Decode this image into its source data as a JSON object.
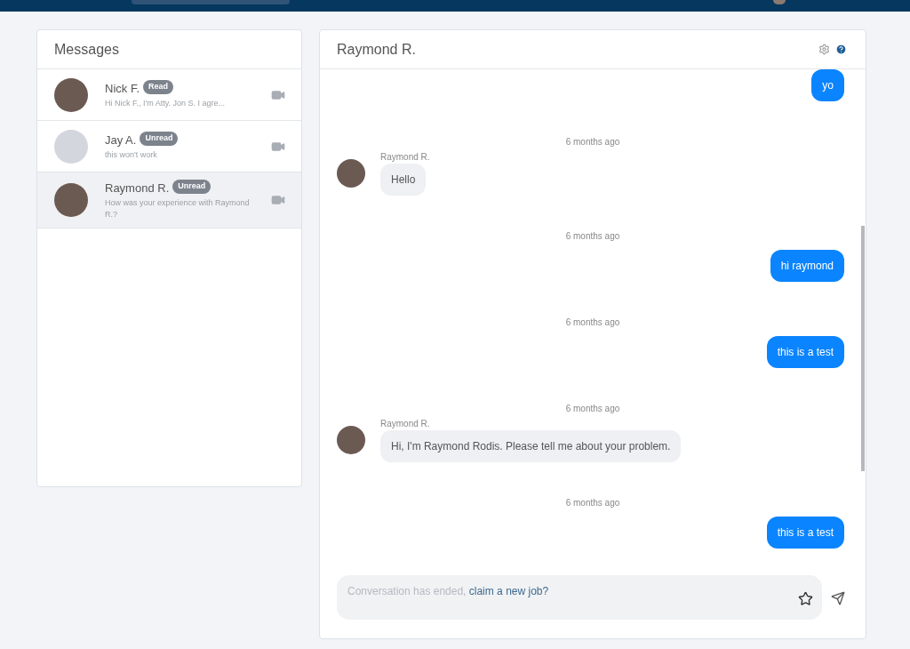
{
  "sidebar": {
    "title": "Messages",
    "conversations": [
      {
        "name": "Nick F.",
        "status": "Read",
        "preview": "Hi Nick F., I'm Atty. Jon S. I agre...",
        "kind": "photo",
        "selected": false
      },
      {
        "name": "Jay A.",
        "status": "Unread",
        "preview": "this won't work",
        "kind": "blank",
        "selected": false
      },
      {
        "name": "Raymond R.",
        "status": "Unread",
        "preview": "How was your experience with Raymond R.?",
        "kind": "photo",
        "selected": true
      }
    ]
  },
  "chat": {
    "title": "Raymond R.",
    "messages": [
      {
        "kind": "outgoing",
        "text": "yo"
      },
      {
        "kind": "incoming",
        "time": "6 months ago",
        "sender": "Raymond R.",
        "text": "Hello"
      },
      {
        "kind": "outgoing",
        "time": "6 months ago",
        "text": "hi raymond"
      },
      {
        "kind": "outgoing",
        "time": "6 months ago",
        "text": "this is a test"
      },
      {
        "kind": "incoming",
        "time": "6 months ago",
        "sender": "Raymond R.",
        "text": "Hi, I'm Raymond Rodis. Please tell me about your problem."
      },
      {
        "kind": "outgoing",
        "time": "6 months ago",
        "text": "this is a test"
      }
    ],
    "composer": {
      "notice": "Conversation has ended,",
      "link": "claim a new job?"
    }
  }
}
